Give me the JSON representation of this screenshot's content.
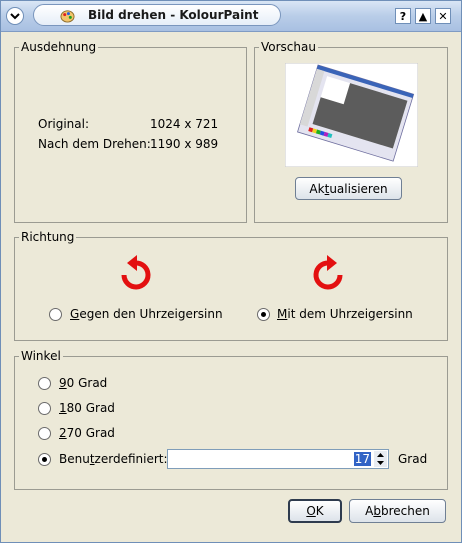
{
  "window": {
    "title": "Bild drehen - KolourPaint"
  },
  "titlebar_buttons": [
    "?",
    "▲",
    "✕"
  ],
  "ausdehnung": {
    "legend": "Ausdehnung",
    "original_label": "Original:",
    "original_value": "1024 x 721",
    "nach_label": "Nach dem Drehen:",
    "nach_value": "1190 x 989"
  },
  "vorschau": {
    "legend": "Vorschau",
    "refresh_button": {
      "pre": "Ak",
      "mnemonic": "t",
      "post": "ualisieren"
    }
  },
  "richtung": {
    "legend": "Richtung",
    "ccw": {
      "mnemonic": "G",
      "rest": "egen den Uhrzeigersinn",
      "selected": false
    },
    "cw": {
      "mnemonic": "M",
      "rest": "it dem Uhrzeigersinn",
      "selected": true
    },
    "icon_color": "#e31010"
  },
  "winkel": {
    "legend": "Winkel",
    "options": [
      {
        "mnemonic": "9",
        "rest": "0 Grad",
        "selected": false
      },
      {
        "mnemonic": "1",
        "rest": "80 Grad",
        "selected": false
      },
      {
        "mnemonic": "2",
        "rest": "70 Grad",
        "selected": false
      }
    ],
    "custom": {
      "pre": "Benu",
      "mnemonic": "t",
      "post": "zerdefiniert:",
      "selected": true
    },
    "custom_value": "17",
    "unit": "Grad"
  },
  "buttons": {
    "ok": {
      "mnemonic": "O",
      "rest": "K"
    },
    "cancel": {
      "pre": "A",
      "mnemonic": "b",
      "post": "brechen"
    }
  }
}
